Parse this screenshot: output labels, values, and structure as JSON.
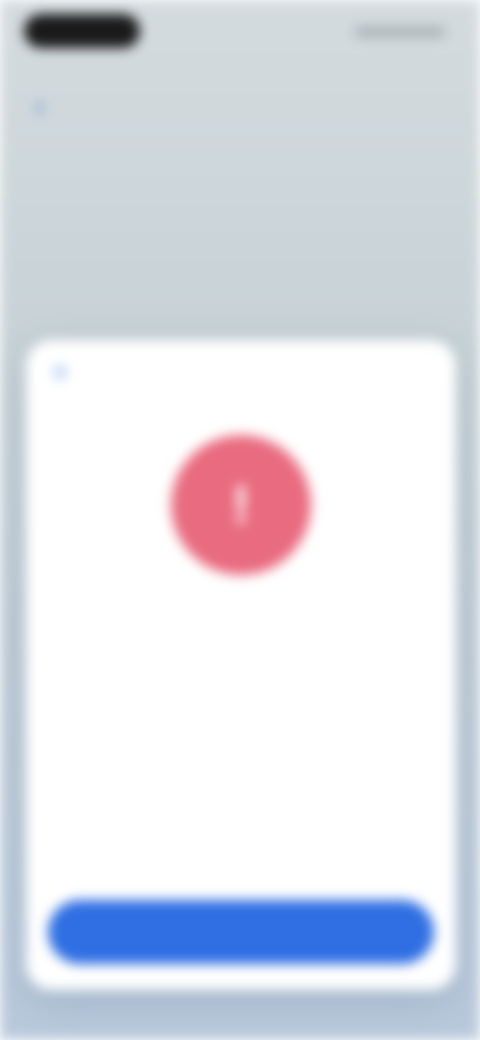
{
  "sheet": {
    "avatar_glyph": "!"
  },
  "colors": {
    "accent": "#2f6fe3",
    "alert": "#e96b7f"
  }
}
